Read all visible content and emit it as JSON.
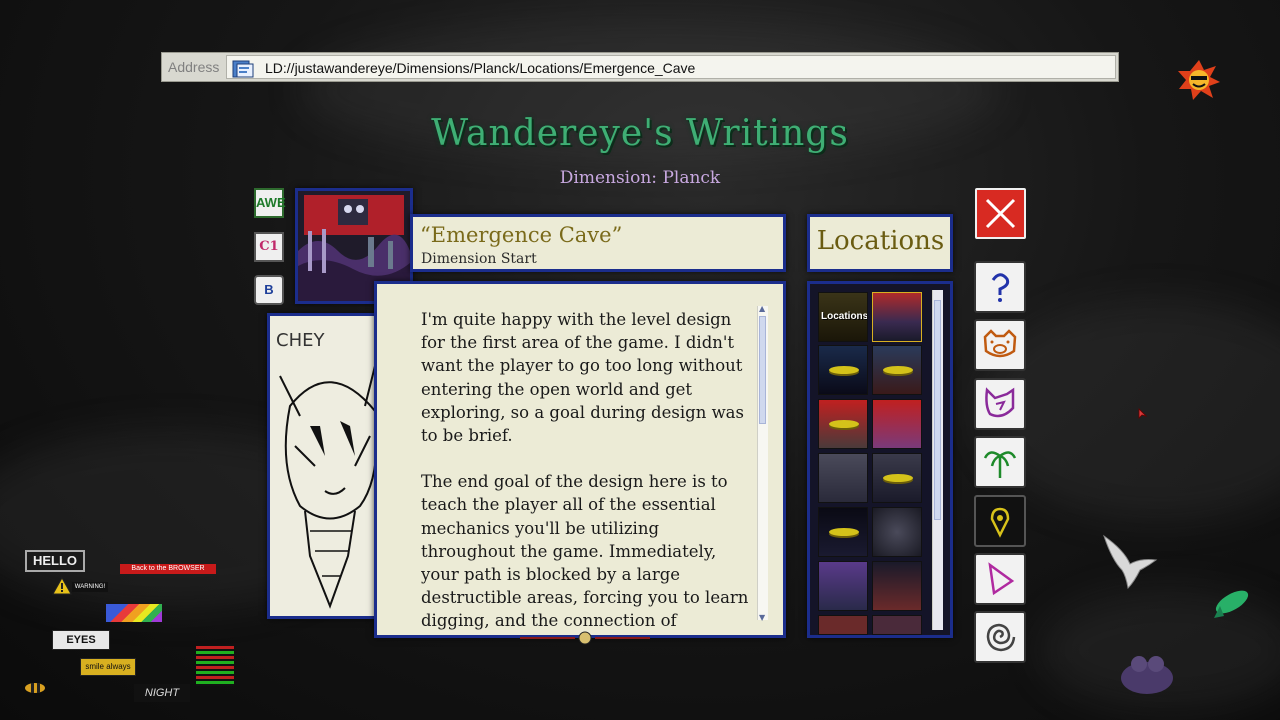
{
  "address_bar": {
    "label": "Address",
    "url": "LD://justawandereye/Dimensions/Planck/Locations/Emergence_Cave"
  },
  "header": {
    "title": "Wandereye's Writings",
    "subtitle": "Dimension: Planck"
  },
  "entry": {
    "title": "“Emergence Cave”",
    "subtitle": "Dimension Start",
    "paragraphs": [
      "I'm quite happy with the level design for the first area of the game. I didn't want the player to go too long without entering the open world and get exploring, so a goal during design was to be brief.",
      "The end goal of the design here is to teach the player all of the essential mechanics you'll be utilizing throughout the game. Immediately, your path is blocked by a large destructible areas, forcing you to learn digging, and the connection of"
    ],
    "sketch_label": "CHEY"
  },
  "side_badges": [
    "AWE",
    "C1",
    "B"
  ],
  "locations": {
    "heading": "Locations",
    "first_tile_label": "Locations",
    "tile_count": 14
  },
  "side_buttons": [
    "close-icon",
    "question-icon",
    "pig-face-icon",
    "cat-face-icon",
    "palm-tree-icon",
    "map-pin-icon",
    "triangle-play-icon",
    "spiral-icon"
  ],
  "desktop_decor": {
    "hello_sticker": "HELLO",
    "warning_sticker": "WARNING!",
    "red_sticker": "Back to the BROWSER",
    "eyes_sticker": "EYES",
    "smile_sticker": "smile always",
    "night_sticker": "NIGHT"
  },
  "colors": {
    "title_green": "#3fae74",
    "subtitle_lilac": "#c8a8e0",
    "panel_border": "#1b2d8c",
    "panel_bg": "#ecebd6",
    "close_red": "#d82a22"
  }
}
